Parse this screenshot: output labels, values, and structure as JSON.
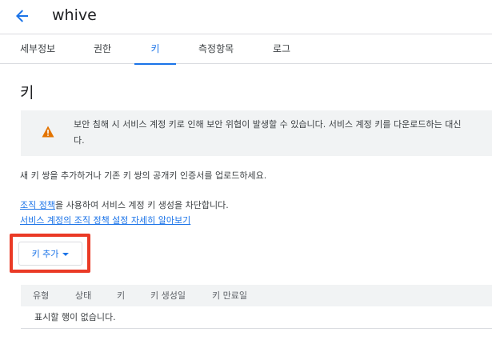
{
  "header": {
    "title": "whive"
  },
  "tabs": [
    {
      "label": "세부정보",
      "active": false
    },
    {
      "label": "권한",
      "active": false
    },
    {
      "label": "키",
      "active": true
    },
    {
      "label": "측정항목",
      "active": false
    },
    {
      "label": "로그",
      "active": false
    }
  ],
  "section": {
    "title": "키"
  },
  "banner": {
    "line1": "보안 침해 시 서비스 계정 키로 인해 보안 위협이 발생할 수 있습니다. 서비스 계정 키를 다운로드하는 대신",
    "line2": "다.",
    "icon": "warning-icon"
  },
  "instruction": "새 키 쌍을 추가하거나 기존 키 쌍의 공개키 인증서를 업로드하세요.",
  "policy": {
    "link_text": "조직 정책",
    "suffix_text": "을 사용하여 서비스 계정 키 생성을 차단합니다.",
    "learn_more": "서비스 계정의 조직 정책 설정 자세히 알아보기"
  },
  "add_key_button": {
    "label": "키 추가"
  },
  "table": {
    "columns": [
      "유형",
      "상태",
      "키",
      "키 생성일",
      "키 만료일"
    ],
    "empty_message": "표시할 행이 없습니다."
  },
  "colors": {
    "accent": "#1a73e8",
    "warning": "#e37400",
    "highlight": "#ea3a26"
  }
}
